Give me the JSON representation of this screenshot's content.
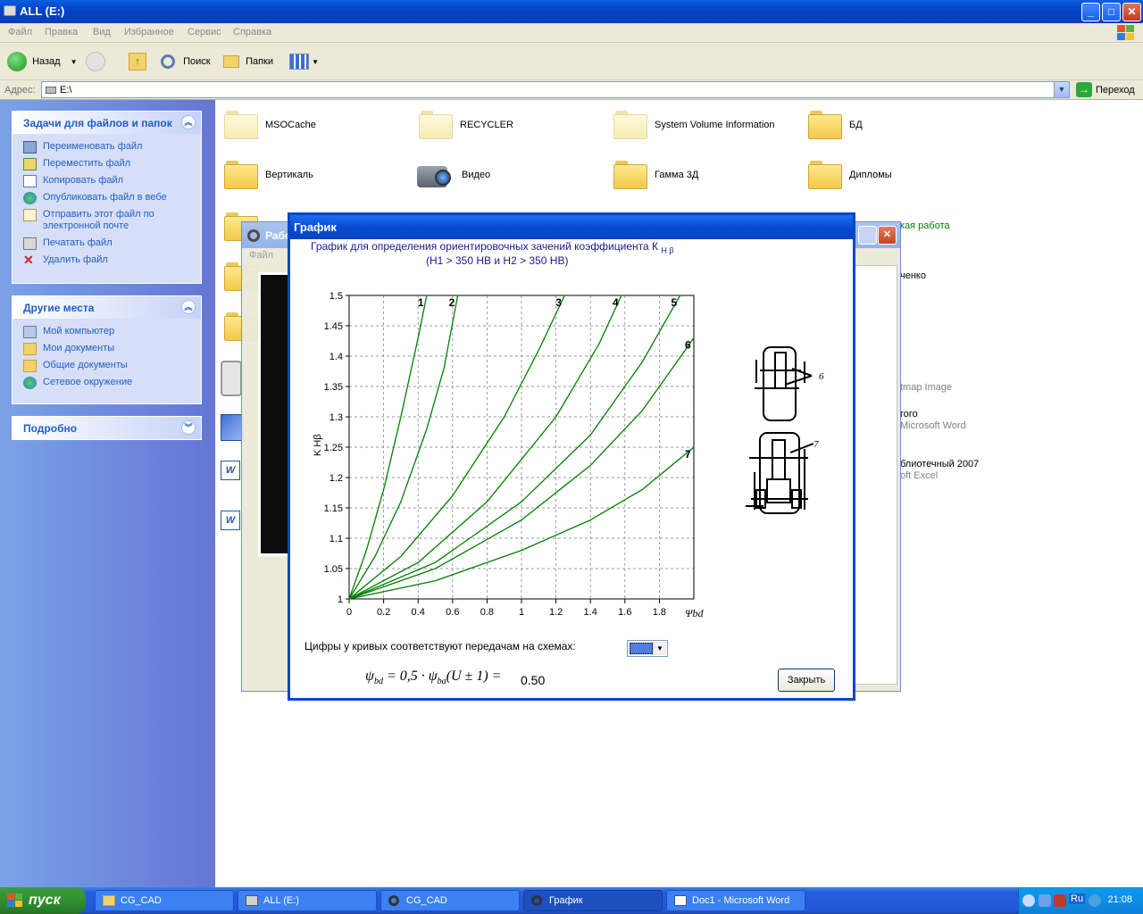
{
  "window": {
    "title": "ALL (E:)"
  },
  "menu": [
    "Файл",
    "Правка",
    "Вид",
    "Избранное",
    "Сервис",
    "Справка"
  ],
  "toolbar": {
    "back": "Назад",
    "search": "Поиск",
    "folders": "Папки"
  },
  "address": {
    "label": "Адрес:",
    "value": "E:\\",
    "go": "Переход"
  },
  "tasks": {
    "title": "Задачи для файлов и папок",
    "items": [
      "Переименовать файл",
      "Переместить файл",
      "Копировать файл",
      "Опубликовать файл в вебе",
      "Отправить этот файл по электронной почте",
      "Печатать файл",
      "Удалить файл"
    ]
  },
  "places": {
    "title": "Другие места",
    "items": [
      "Мой компьютер",
      "Мои документы",
      "Общие документы",
      "Сетевое окружение"
    ]
  },
  "details": {
    "title": "Подробно"
  },
  "files": [
    "MSOCache",
    "RECYCLER",
    "System Volume Information",
    "БД",
    "Вертикаль",
    "Видео",
    "Гамма 3Д",
    "Дипломы"
  ],
  "bg_fragments": [
    "кая работа",
    "ченко",
    "tmap Image",
    "гого",
    "Microsoft Word",
    "блиотечный 2007",
    "oft Excel"
  ],
  "bg_dialog": {
    "title": "Рабо",
    "menu": "Файл"
  },
  "dialog": {
    "title": "График",
    "chart_title_1": "График для определения ориентировочных зачений коэффициента К",
    "chart_title_sub": "H β",
    "chart_title_2": "(H1 > 350 HB и H2 > 350 HB)",
    "legend_label": "Цифры у кривых соответствуют передачам на схемах:",
    "formula_value": "0.50",
    "close": "Закрыть"
  },
  "chart_data": {
    "type": "line",
    "title": "График для определения ориентировочных зачений коэффициента K Hβ (H1 > 350 HB и H2 > 350 HB)",
    "xlabel": "Ψbd",
    "ylabel": "K Hβ",
    "xlim": [
      0,
      2.0
    ],
    "ylim": [
      1.0,
      1.5
    ],
    "xticks": [
      "0",
      "0.2",
      "0.4",
      "0.6",
      "0.8",
      "1",
      "1.2",
      "1.4",
      "1.6",
      "1.8"
    ],
    "yticks": [
      "1",
      "1.05",
      "1.1",
      "1.15",
      "1.2",
      "1.25",
      "1.3",
      "1.35",
      "1.4",
      "1.45",
      "1.5"
    ],
    "grid": true,
    "color": "#008000",
    "series": [
      {
        "name": "1",
        "x": [
          0,
          0.1,
          0.2,
          0.3,
          0.4,
          0.45
        ],
        "y": [
          1.0,
          1.08,
          1.18,
          1.3,
          1.43,
          1.5
        ]
      },
      {
        "name": "2",
        "x": [
          0,
          0.15,
          0.3,
          0.45,
          0.55,
          0.63
        ],
        "y": [
          1.0,
          1.07,
          1.16,
          1.28,
          1.38,
          1.5
        ]
      },
      {
        "name": "3",
        "x": [
          0,
          0.3,
          0.6,
          0.9,
          1.1,
          1.25
        ],
        "y": [
          1.0,
          1.07,
          1.17,
          1.3,
          1.41,
          1.5
        ]
      },
      {
        "name": "4",
        "x": [
          0,
          0.4,
          0.8,
          1.2,
          1.45,
          1.58
        ],
        "y": [
          1.0,
          1.06,
          1.16,
          1.3,
          1.42,
          1.5
        ]
      },
      {
        "name": "5",
        "x": [
          0,
          0.5,
          1.0,
          1.4,
          1.7,
          1.92
        ],
        "y": [
          1.0,
          1.06,
          1.16,
          1.27,
          1.39,
          1.5
        ]
      },
      {
        "name": "6",
        "x": [
          0,
          0.5,
          1.0,
          1.4,
          1.7,
          2.0
        ],
        "y": [
          1.0,
          1.05,
          1.13,
          1.22,
          1.31,
          1.43
        ]
      },
      {
        "name": "7",
        "x": [
          0,
          0.5,
          1.0,
          1.4,
          1.7,
          2.0
        ],
        "y": [
          1.0,
          1.03,
          1.08,
          1.13,
          1.18,
          1.25
        ]
      }
    ]
  },
  "taskbar": {
    "start": "пуск",
    "buttons": [
      "CG_CAD",
      "ALL (E:)",
      "CG_CAD",
      "График",
      "Doc1 - Microsoft Word"
    ],
    "lang": "Ru",
    "clock": "21:08"
  }
}
